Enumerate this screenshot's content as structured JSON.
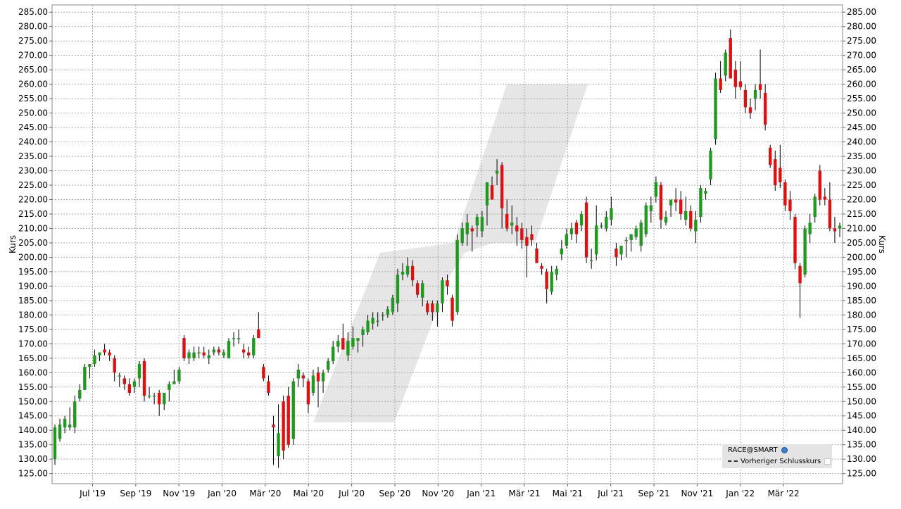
{
  "chart_data": {
    "type": "candlestick",
    "ylabel_left": "Kurs",
    "ylabel_right": "Kurs",
    "ylim": [
      121.5,
      287.5
    ],
    "y_ticks": [
      "285.00",
      "280.00",
      "275.00",
      "270.00",
      "265.00",
      "260.00",
      "255.00",
      "250.00",
      "245.00",
      "240.00",
      "235.00",
      "230.00",
      "225.00",
      "220.00",
      "215.00",
      "210.00",
      "205.00",
      "200.00",
      "195.00",
      "190.00",
      "185.00",
      "180.00",
      "175.00",
      "170.00",
      "165.00",
      "160.00",
      "155.00",
      "150.00",
      "145.00",
      "140.00",
      "135.00",
      "130.00",
      "125.00"
    ],
    "x_ticks": [
      "Jul '19",
      "Sep '19",
      "Nov '19",
      "Jan '20",
      "Mär '20",
      "Mai '20",
      "Jul '20",
      "Sep '20",
      "Nov '20",
      "Jan '21",
      "Mär '21",
      "Mai '21",
      "Jul '21",
      "Sep '21",
      "Nov '21",
      "Jan '22",
      "Mär '22"
    ],
    "grid": true,
    "legend_position": "bottom-right",
    "legend": {
      "symbol": "RACE@SMART",
      "series": "Vorheriger Schlusskurs"
    },
    "colors": {
      "up": "#1f9a1f",
      "down": "#e01010",
      "wick": "#000000",
      "grid": "#a8a8a8",
      "watermark": "#e6e6e6",
      "legend_bg": "#e4e4e4"
    },
    "candles": [
      {
        "o": 130,
        "h": 142,
        "l": 128,
        "c": 141
      },
      {
        "o": 137,
        "h": 144,
        "l": 136,
        "c": 142
      },
      {
        "o": 141,
        "h": 145,
        "l": 139,
        "c": 144
      },
      {
        "o": 141,
        "h": 148,
        "l": 140,
        "c": 142
      },
      {
        "o": 141,
        "h": 152,
        "l": 139,
        "c": 150
      },
      {
        "o": 151,
        "h": 156,
        "l": 150,
        "c": 154
      },
      {
        "o": 154,
        "h": 163,
        "l": 154,
        "c": 162
      },
      {
        "o": 162,
        "h": 163,
        "l": 158,
        "c": 163
      },
      {
        "o": 163,
        "h": 168,
        "l": 162,
        "c": 166
      },
      {
        "o": 166,
        "h": 167,
        "l": 164,
        "c": 167
      },
      {
        "o": 168,
        "h": 170,
        "l": 166,
        "c": 167
      },
      {
        "o": 167,
        "h": 168,
        "l": 164,
        "c": 166
      },
      {
        "o": 165,
        "h": 166,
        "l": 157,
        "c": 160
      },
      {
        "o": 159,
        "h": 160,
        "l": 155,
        "c": 159
      },
      {
        "o": 158,
        "h": 159,
        "l": 154,
        "c": 156
      },
      {
        "o": 156,
        "h": 158,
        "l": 152,
        "c": 153
      },
      {
        "o": 155,
        "h": 158,
        "l": 153,
        "c": 157
      },
      {
        "o": 158,
        "h": 164,
        "l": 155,
        "c": 163
      },
      {
        "o": 164,
        "h": 165,
        "l": 150,
        "c": 152
      },
      {
        "o": 152,
        "h": 155,
        "l": 151,
        "c": 152
      },
      {
        "o": 152,
        "h": 153,
        "l": 149,
        "c": 152
      },
      {
        "o": 153,
        "h": 154,
        "l": 145,
        "c": 149
      },
      {
        "o": 149,
        "h": 153,
        "l": 147,
        "c": 153
      },
      {
        "o": 154,
        "h": 157,
        "l": 150,
        "c": 156
      },
      {
        "o": 156,
        "h": 161,
        "l": 156,
        "c": 157
      },
      {
        "o": 157,
        "h": 162,
        "l": 156,
        "c": 161
      },
      {
        "o": 172,
        "h": 173,
        "l": 164,
        "c": 165
      },
      {
        "o": 165,
        "h": 168,
        "l": 163,
        "c": 167
      },
      {
        "o": 165,
        "h": 169,
        "l": 164,
        "c": 167
      },
      {
        "o": 167,
        "h": 169,
        "l": 165,
        "c": 167
      },
      {
        "o": 167,
        "h": 169,
        "l": 165,
        "c": 166
      },
      {
        "o": 165,
        "h": 168,
        "l": 163,
        "c": 166
      },
      {
        "o": 167,
        "h": 169,
        "l": 166,
        "c": 168
      },
      {
        "o": 168,
        "h": 169,
        "l": 166,
        "c": 167
      },
      {
        "o": 166,
        "h": 168,
        "l": 165,
        "c": 167
      },
      {
        "o": 165,
        "h": 172,
        "l": 165,
        "c": 171
      },
      {
        "o": 172,
        "h": 174,
        "l": 169,
        "c": 172
      },
      {
        "o": 172,
        "h": 175,
        "l": 170,
        "c": 172
      },
      {
        "o": 168,
        "h": 170,
        "l": 165,
        "c": 167
      },
      {
        "o": 167,
        "h": 169,
        "l": 165,
        "c": 166
      },
      {
        "o": 166,
        "h": 173,
        "l": 165,
        "c": 172
      },
      {
        "o": 175,
        "h": 181,
        "l": 172,
        "c": 172
      },
      {
        "o": 162,
        "h": 163,
        "l": 157,
        "c": 158
      },
      {
        "o": 157,
        "h": 159,
        "l": 152,
        "c": 153
      },
      {
        "o": 142,
        "h": 145,
        "l": 128,
        "c": 141
      },
      {
        "o": 131,
        "h": 149,
        "l": 127,
        "c": 139
      },
      {
        "o": 150,
        "h": 152,
        "l": 130,
        "c": 133
      },
      {
        "o": 152,
        "h": 155,
        "l": 134,
        "c": 135
      },
      {
        "o": 137,
        "h": 158,
        "l": 135,
        "c": 157
      },
      {
        "o": 158,
        "h": 163,
        "l": 155,
        "c": 161
      },
      {
        "o": 159,
        "h": 160,
        "l": 155,
        "c": 158
      },
      {
        "o": 157,
        "h": 158,
        "l": 146,
        "c": 149
      },
      {
        "o": 153,
        "h": 161,
        "l": 152,
        "c": 159
      },
      {
        "o": 160,
        "h": 162,
        "l": 148,
        "c": 157
      },
      {
        "o": 157,
        "h": 161,
        "l": 153,
        "c": 160
      },
      {
        "o": 161,
        "h": 165,
        "l": 160,
        "c": 164
      },
      {
        "o": 164,
        "h": 171,
        "l": 163,
        "c": 169
      },
      {
        "o": 169,
        "h": 173,
        "l": 167,
        "c": 171
      },
      {
        "o": 172,
        "h": 177,
        "l": 168,
        "c": 168
      },
      {
        "o": 166,
        "h": 174,
        "l": 164,
        "c": 171
      },
      {
        "o": 169,
        "h": 176,
        "l": 168,
        "c": 172
      },
      {
        "o": 171,
        "h": 172,
        "l": 167,
        "c": 172
      },
      {
        "o": 173,
        "h": 176,
        "l": 169,
        "c": 175
      },
      {
        "o": 174,
        "h": 180,
        "l": 173,
        "c": 178
      },
      {
        "o": 177,
        "h": 181,
        "l": 175,
        "c": 179
      },
      {
        "o": 178,
        "h": 181,
        "l": 176,
        "c": 178
      },
      {
        "o": 180,
        "h": 181,
        "l": 178,
        "c": 180
      },
      {
        "o": 180,
        "h": 183,
        "l": 179,
        "c": 182
      },
      {
        "o": 181,
        "h": 187,
        "l": 180,
        "c": 186
      },
      {
        "o": 184,
        "h": 196,
        "l": 181,
        "c": 194
      },
      {
        "o": 194,
        "h": 198,
        "l": 192,
        "c": 195
      },
      {
        "o": 194,
        "h": 200,
        "l": 193,
        "c": 197
      },
      {
        "o": 197,
        "h": 199,
        "l": 190,
        "c": 192
      },
      {
        "o": 191,
        "h": 192,
        "l": 186,
        "c": 187
      },
      {
        "o": 186,
        "h": 192,
        "l": 183,
        "c": 191
      },
      {
        "o": 184,
        "h": 185,
        "l": 180,
        "c": 181
      },
      {
        "o": 184,
        "h": 185,
        "l": 178,
        "c": 181
      },
      {
        "o": 181,
        "h": 185,
        "l": 176,
        "c": 184
      },
      {
        "o": 184,
        "h": 193,
        "l": 181,
        "c": 192
      },
      {
        "o": 192,
        "h": 194,
        "l": 187,
        "c": 190
      },
      {
        "o": 186,
        "h": 187,
        "l": 176,
        "c": 178
      },
      {
        "o": 181,
        "h": 208,
        "l": 180,
        "c": 206
      },
      {
        "o": 205,
        "h": 212,
        "l": 204,
        "c": 210
      },
      {
        "o": 208,
        "h": 215,
        "l": 204,
        "c": 212
      },
      {
        "o": 210,
        "h": 211,
        "l": 202,
        "c": 209
      },
      {
        "o": 211,
        "h": 215,
        "l": 207,
        "c": 214
      },
      {
        "o": 209,
        "h": 216,
        "l": 207,
        "c": 214
      },
      {
        "o": 218,
        "h": 226,
        "l": 211,
        "c": 226
      },
      {
        "o": 225,
        "h": 228,
        "l": 220,
        "c": 220
      },
      {
        "o": 229,
        "h": 234,
        "l": 225,
        "c": 230
      },
      {
        "o": 232,
        "h": 233,
        "l": 210,
        "c": 217
      },
      {
        "o": 215,
        "h": 220,
        "l": 209,
        "c": 210
      },
      {
        "o": 211,
        "h": 218,
        "l": 208,
        "c": 212
      },
      {
        "o": 211,
        "h": 214,
        "l": 204,
        "c": 209
      },
      {
        "o": 210,
        "h": 212,
        "l": 203,
        "c": 206
      },
      {
        "o": 207,
        "h": 210,
        "l": 193,
        "c": 204
      },
      {
        "o": 208,
        "h": 211,
        "l": 204,
        "c": 206
      },
      {
        "o": 203,
        "h": 205,
        "l": 198,
        "c": 198
      },
      {
        "o": 197,
        "h": 198,
        "l": 194,
        "c": 196
      },
      {
        "o": 195,
        "h": 196,
        "l": 184,
        "c": 189
      },
      {
        "o": 188,
        "h": 197,
        "l": 187,
        "c": 195
      },
      {
        "o": 194,
        "h": 197,
        "l": 192,
        "c": 196
      },
      {
        "o": 201,
        "h": 206,
        "l": 199,
        "c": 203
      },
      {
        "o": 204,
        "h": 210,
        "l": 203,
        "c": 208
      },
      {
        "o": 208,
        "h": 212,
        "l": 206,
        "c": 210
      },
      {
        "o": 212,
        "h": 213,
        "l": 205,
        "c": 208
      },
      {
        "o": 211,
        "h": 216,
        "l": 209,
        "c": 215
      },
      {
        "o": 219,
        "h": 221,
        "l": 198,
        "c": 200
      },
      {
        "o": 199,
        "h": 203,
        "l": 196,
        "c": 199
      },
      {
        "o": 201,
        "h": 218,
        "l": 199,
        "c": 211
      },
      {
        "o": 211,
        "h": 212,
        "l": 210,
        "c": 211
      },
      {
        "o": 210,
        "h": 216,
        "l": 209,
        "c": 214
      },
      {
        "o": 213,
        "h": 221,
        "l": 211,
        "c": 217
      },
      {
        "o": 203,
        "h": 205,
        "l": 197,
        "c": 200
      },
      {
        "o": 201,
        "h": 204,
        "l": 199,
        "c": 204
      },
      {
        "o": 206,
        "h": 207,
        "l": 200,
        "c": 206
      },
      {
        "o": 206,
        "h": 208,
        "l": 202,
        "c": 208
      },
      {
        "o": 207,
        "h": 211,
        "l": 206,
        "c": 210
      },
      {
        "o": 204,
        "h": 213,
        "l": 202,
        "c": 212
      },
      {
        "o": 208,
        "h": 219,
        "l": 207,
        "c": 218
      },
      {
        "o": 216,
        "h": 221,
        "l": 212,
        "c": 218
      },
      {
        "o": 221,
        "h": 228,
        "l": 219,
        "c": 226
      },
      {
        "o": 225,
        "h": 226,
        "l": 210,
        "c": 213
      },
      {
        "o": 212,
        "h": 216,
        "l": 211,
        "c": 214
      },
      {
        "o": 218,
        "h": 220,
        "l": 214,
        "c": 220
      },
      {
        "o": 220,
        "h": 224,
        "l": 216,
        "c": 219
      },
      {
        "o": 220,
        "h": 223,
        "l": 213,
        "c": 215
      },
      {
        "o": 213,
        "h": 221,
        "l": 211,
        "c": 216
      },
      {
        "o": 216,
        "h": 218,
        "l": 209,
        "c": 210
      },
      {
        "o": 209,
        "h": 216,
        "l": 205,
        "c": 213
      },
      {
        "o": 214,
        "h": 225,
        "l": 212,
        "c": 224
      },
      {
        "o": 222,
        "h": 224,
        "l": 220,
        "c": 223
      },
      {
        "o": 227,
        "h": 238,
        "l": 225,
        "c": 237
      },
      {
        "o": 241,
        "h": 264,
        "l": 239,
        "c": 262
      },
      {
        "o": 262,
        "h": 268,
        "l": 257,
        "c": 258
      },
      {
        "o": 263,
        "h": 272,
        "l": 261,
        "c": 271
      },
      {
        "o": 276,
        "h": 279,
        "l": 262,
        "c": 262
      },
      {
        "o": 265,
        "h": 268,
        "l": 255,
        "c": 259
      },
      {
        "o": 261,
        "h": 268,
        "l": 258,
        "c": 259
      },
      {
        "o": 258,
        "h": 260,
        "l": 250,
        "c": 252
      },
      {
        "o": 252,
        "h": 255,
        "l": 248,
        "c": 250
      },
      {
        "o": 255,
        "h": 260,
        "l": 251,
        "c": 258
      },
      {
        "o": 260,
        "h": 272,
        "l": 255,
        "c": 258
      },
      {
        "o": 257,
        "h": 260,
        "l": 244,
        "c": 246
      },
      {
        "o": 238,
        "h": 239,
        "l": 231,
        "c": 232
      },
      {
        "o": 234,
        "h": 237,
        "l": 223,
        "c": 225
      },
      {
        "o": 231,
        "h": 239,
        "l": 224,
        "c": 226
      },
      {
        "o": 226,
        "h": 227,
        "l": 216,
        "c": 218
      },
      {
        "o": 220,
        "h": 223,
        "l": 213,
        "c": 216
      },
      {
        "o": 214,
        "h": 215,
        "l": 196,
        "c": 198
      },
      {
        "o": 197,
        "h": 198,
        "l": 179,
        "c": 191
      },
      {
        "o": 194,
        "h": 211,
        "l": 193,
        "c": 210
      },
      {
        "o": 208,
        "h": 215,
        "l": 205,
        "c": 212
      },
      {
        "o": 214,
        "h": 222,
        "l": 212,
        "c": 221
      },
      {
        "o": 230,
        "h": 232,
        "l": 218,
        "c": 220
      },
      {
        "o": 221,
        "h": 224,
        "l": 218,
        "c": 220
      },
      {
        "o": 220,
        "h": 226,
        "l": 209,
        "c": 210
      },
      {
        "o": 210,
        "h": 214,
        "l": 205,
        "c": 209
      },
      {
        "o": 210,
        "h": 212,
        "l": 207,
        "c": 211
      }
    ]
  }
}
